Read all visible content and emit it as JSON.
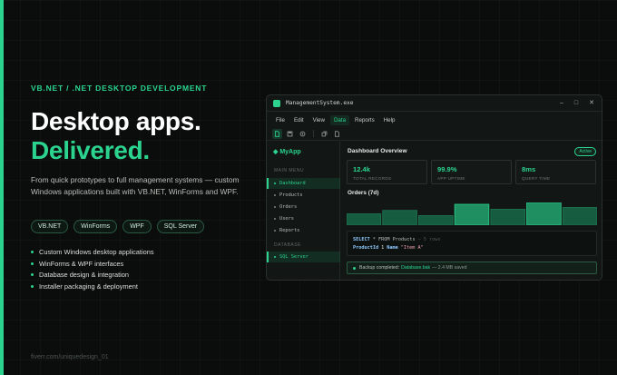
{
  "hero": {
    "eyebrow": "VB.NET / .NET DESKTOP DEVELOPMENT",
    "title_line1": "Desktop apps.",
    "title_line2": "Delivered.",
    "description": "From quick prototypes to full management systems — custom Windows applications built with VB.NET, WinForms and WPF.",
    "tags": [
      "VB.NET",
      "WinForms",
      "WPF",
      "SQL Server"
    ],
    "features": [
      "Custom Windows desktop applications",
      "WinForms & WPF interfaces",
      "Database design & integration",
      "Installer packaging & deployment"
    ],
    "footer": "fiverr.com/uniquedesign_01"
  },
  "colors": {
    "accent": "#2bd38f",
    "background": "#0b0d0c",
    "window": "#121614"
  },
  "window": {
    "title": "ManagementSystem.exe",
    "controls": [
      "–",
      "□",
      "✕"
    ],
    "menu": [
      "File",
      "Edit",
      "View",
      "Data",
      "Reports",
      "Help"
    ],
    "active_menu": "Data",
    "toolbar_icons": [
      "new-file-icon",
      "save-icon",
      "print-icon",
      "copy-icon",
      "paste-icon"
    ]
  },
  "sidebar": {
    "brand": "◆ MyApp",
    "section_main": "MAIN MENU",
    "items": [
      "Dashboard",
      "Products",
      "Orders",
      "Users",
      "Reports"
    ],
    "section_db": "DATABASE",
    "db_item": "SQL Server",
    "active": [
      "Dashboard",
      "SQL Server"
    ]
  },
  "dashboard": {
    "title": "Dashboard Overview",
    "badge": "Active",
    "stats": [
      {
        "value": "12.4k",
        "label": "TOTAL RECORDS"
      },
      {
        "value": "99.9%",
        "label": "APP UPTIME"
      },
      {
        "value": "8ms",
        "label": "QUERY TIME"
      }
    ],
    "orders_title": "Orders (7d)",
    "orders_bars": [
      0.5,
      0.65,
      0.42,
      0.92,
      0.7,
      1.0,
      0.78
    ],
    "query": {
      "kw1": "SELECT",
      "mid": "* FROM Products",
      "comment": "— 5 rows",
      "col1": "ProductId",
      "val1": "1",
      "col2": "Name",
      "val2": "\"Item A\""
    },
    "status": {
      "text": "Backup completed:",
      "file": "Database.bak",
      "detail": "— 2.4 MB saved"
    }
  }
}
